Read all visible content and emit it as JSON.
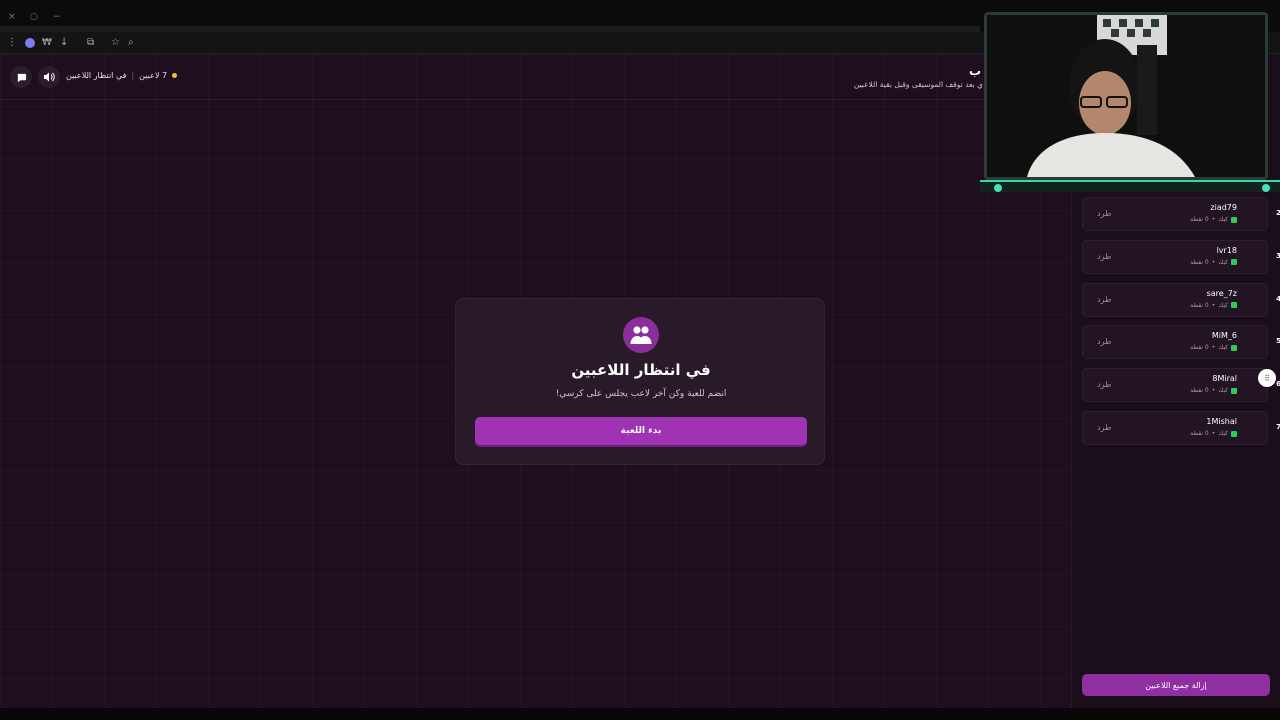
{
  "browser": {
    "window_controls": [
      "×",
      "○",
      "−"
    ],
    "toolbar_glyphs": [
      "⋮",
      "↓",
      "⧉",
      "☆",
      "⌕"
    ]
  },
  "header": {
    "title": "ب",
    "subtitle": "ي بعد توقف الموسيقى وقبل بقية اللاعبين",
    "players_count": "7 لاعبين",
    "status": "في انتظار اللاعبين",
    "separator": "|"
  },
  "card": {
    "title": "في انتظار اللاعبين",
    "subtitle": "انضم للعبة وكن آخر لاعب يجلس على كرسي!",
    "start_label": "بدء اللعبة",
    "icon": "users-icon"
  },
  "players": [
    {
      "rank": "2",
      "name": "ziad79",
      "status": "كيك",
      "points": "0 نقطة",
      "kick": "طرد"
    },
    {
      "rank": "3",
      "name": "lvr18",
      "status": "كيك",
      "points": "0 نقطة",
      "kick": "طرد"
    },
    {
      "rank": "4",
      "name": "sare_7z",
      "status": "كيك",
      "points": "0 نقطة",
      "kick": "طرد"
    },
    {
      "rank": "5",
      "name": "MiM_6",
      "status": "كيك",
      "points": "0 نقطة",
      "kick": "طرد"
    },
    {
      "rank": "6",
      "name": "8Miral",
      "status": "كيك",
      "points": "0 نقطة",
      "kick": "طرد"
    },
    {
      "rank": "7",
      "name": "1Mishal",
      "status": "كيك",
      "points": "0 نقطة",
      "kick": "طرد"
    }
  ],
  "sidebar": {
    "remove_all_label": "إزالة جميع اللاعبين"
  },
  "colors": {
    "accent": "#a033b4",
    "background": "#1e0f1e",
    "status_dot": "#f3c12b",
    "flag": "#2ecc55"
  }
}
